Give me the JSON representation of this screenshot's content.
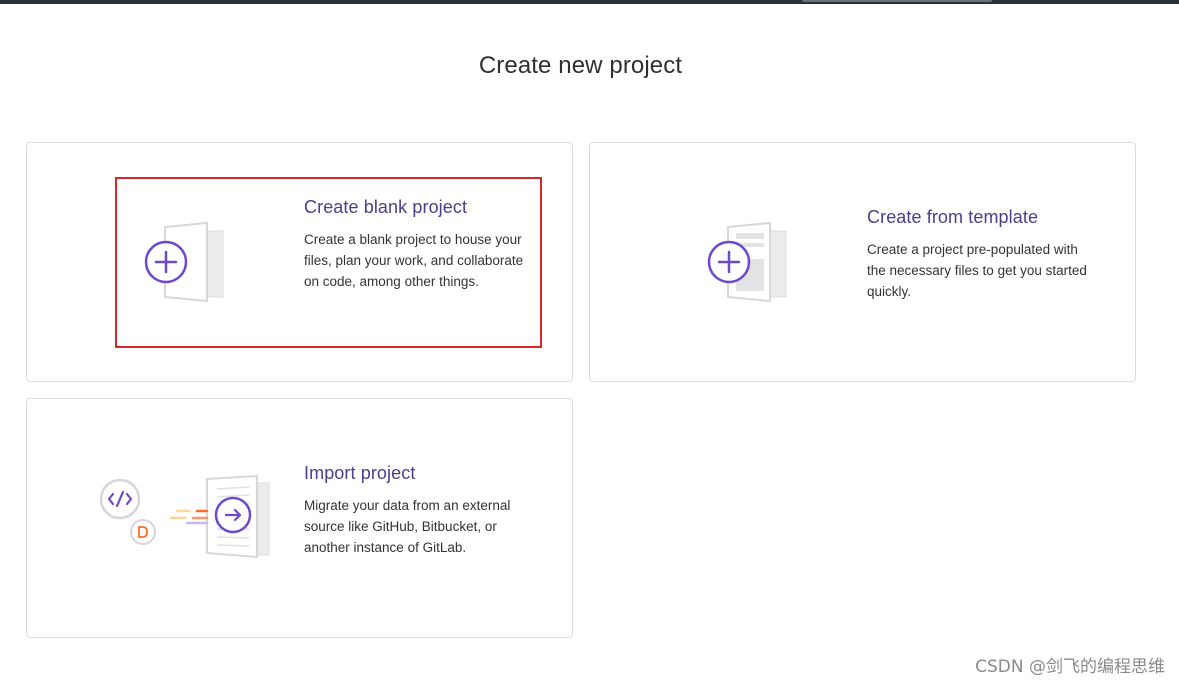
{
  "page": {
    "title": "Create new project"
  },
  "cards": {
    "blank": {
      "title": "Create blank project",
      "description": "Create a blank project to house your files, plan your work, and collaborate on code, among other things.",
      "icon": "blank-project-icon"
    },
    "template": {
      "title": "Create from template",
      "description": "Create a project pre-populated with the necessary files to get you started quickly.",
      "icon": "template-project-icon"
    },
    "import": {
      "title": "Import project",
      "description": "Migrate your data from an external source like GitHub, Bitbucket, or another instance of GitLab.",
      "icon": "import-project-icon"
    }
  },
  "watermark": "CSDN @剑飞的编程思维",
  "colors": {
    "accent": "#463f8f",
    "icon_purple": "#6e49cb",
    "highlight_border": "#d8262c",
    "card_border": "#dcdcde",
    "orange": "#fc6d26"
  }
}
